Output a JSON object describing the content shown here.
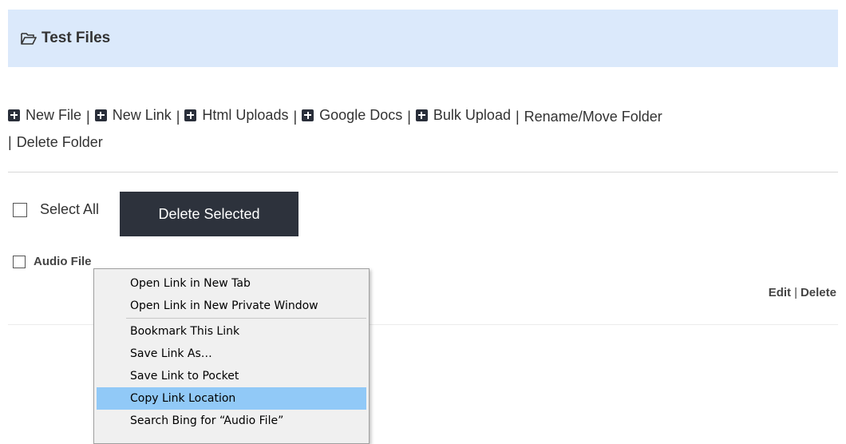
{
  "folder": {
    "title": "Test Files",
    "icon": "folder-open-icon"
  },
  "toolbar": {
    "items": [
      {
        "label": "New File",
        "icon": "plus-square-icon"
      },
      {
        "label": "New Link",
        "icon": "plus-square-icon"
      },
      {
        "label": "Html Uploads",
        "icon": "plus-square-icon"
      },
      {
        "label": "Google Docs",
        "icon": "plus-square-icon"
      },
      {
        "label": "Bulk Upload",
        "icon": "plus-square-icon"
      }
    ],
    "rename": "Rename/Move Folder",
    "delete": "Delete Folder",
    "separator": "|"
  },
  "selection": {
    "select_all_label": "Select All",
    "delete_selected_label": "Delete Selected"
  },
  "files": [
    {
      "name": "Audio File",
      "edit": "Edit",
      "delete": "Delete",
      "separator": "|"
    }
  ],
  "context_menu": {
    "items": [
      {
        "label": "Open Link in New Tab"
      },
      {
        "label": "Open Link in New Private Window"
      },
      {
        "label": "Bookmark This Link"
      },
      {
        "label": "Save Link As…"
      },
      {
        "label": "Save Link to Pocket"
      },
      {
        "label": "Copy Link Location",
        "highlighted": true
      },
      {
        "label": "Search Bing for “Audio File”"
      }
    ]
  },
  "colors": {
    "header_bg": "#dbe9fb",
    "button_bg": "#2d323c",
    "menu_highlight": "#91c9f7"
  }
}
